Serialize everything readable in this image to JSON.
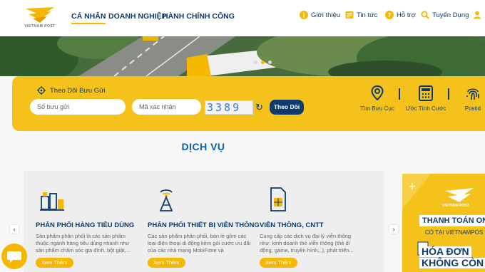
{
  "brand": {
    "logo_text": "VIETNAM POST",
    "accent": "#f5b700",
    "navy": "#0d3b6e"
  },
  "nav": {
    "items": [
      "CÁ NHÂN",
      "DOANH NGHIỆP",
      "HÀNH CHÍNH CÔNG"
    ]
  },
  "top_links": [
    {
      "label": "Giới thiệu",
      "icon": "info-icon"
    },
    {
      "label": "Tin tức",
      "icon": "news-icon"
    },
    {
      "label": "Hỗ trợ",
      "icon": "help-icon"
    },
    {
      "label": "Tuyển Dụng",
      "icon": "search-person-icon"
    }
  ],
  "tracking": {
    "title": "Theo Dõi Bưu Gửi",
    "parcel_placeholder": "Số bưu gửi",
    "captcha_placeholder": "Mã xác nhận",
    "captcha_text": "3389",
    "button": "Theo Dõi"
  },
  "quick_actions": [
    {
      "label": "Tìm Bưu Cục",
      "icon": "location-pin-icon"
    },
    {
      "label": "Ước Tính Cước",
      "icon": "calculator-icon"
    },
    {
      "label": "Postid",
      "icon": "fingerprint-icon"
    }
  ],
  "services": {
    "title": "DỊCH VỤ",
    "more_label": "Xem Thêm",
    "cards": [
      {
        "title": "PHÂN PHỐI HÀNG TIÊU DÙNG",
        "desc": "Sản phẩm phân phối là các sản phẩm thuộc ngành hàng tiêu dùng nhanh như sản phẩm chăm sóc gia đình, bột giặt,...",
        "icon": "consumer-goods-icon"
      },
      {
        "title": "PHÂN PHỐI THIẾT BỊ VIỄN THÔNG",
        "desc": "Các sản phẩm phân phối, bán lẻ gồm các loại điện thoại di động kèm gói cước ưu đãi của các nhà mạng MobiFone và",
        "icon": "antenna-icon"
      },
      {
        "title": "VIỄN THÔNG, CNTT",
        "desc": "Cung cấp các dịch vụ đại lý viễn thông như: kinh doanh thẻ viễn thông (thẻ di động, game, truyền hình,..), phát triển...",
        "icon": "sim-card-icon"
      }
    ]
  },
  "promo": {
    "logo_text": "VIETNAM POST",
    "headline": "THANH TOÁN ON",
    "sub": "CÓ TẠI VIETNAMPOS",
    "big_lines": [
      "HÓA ĐƠN",
      "KHÔNG CÒN"
    ]
  }
}
